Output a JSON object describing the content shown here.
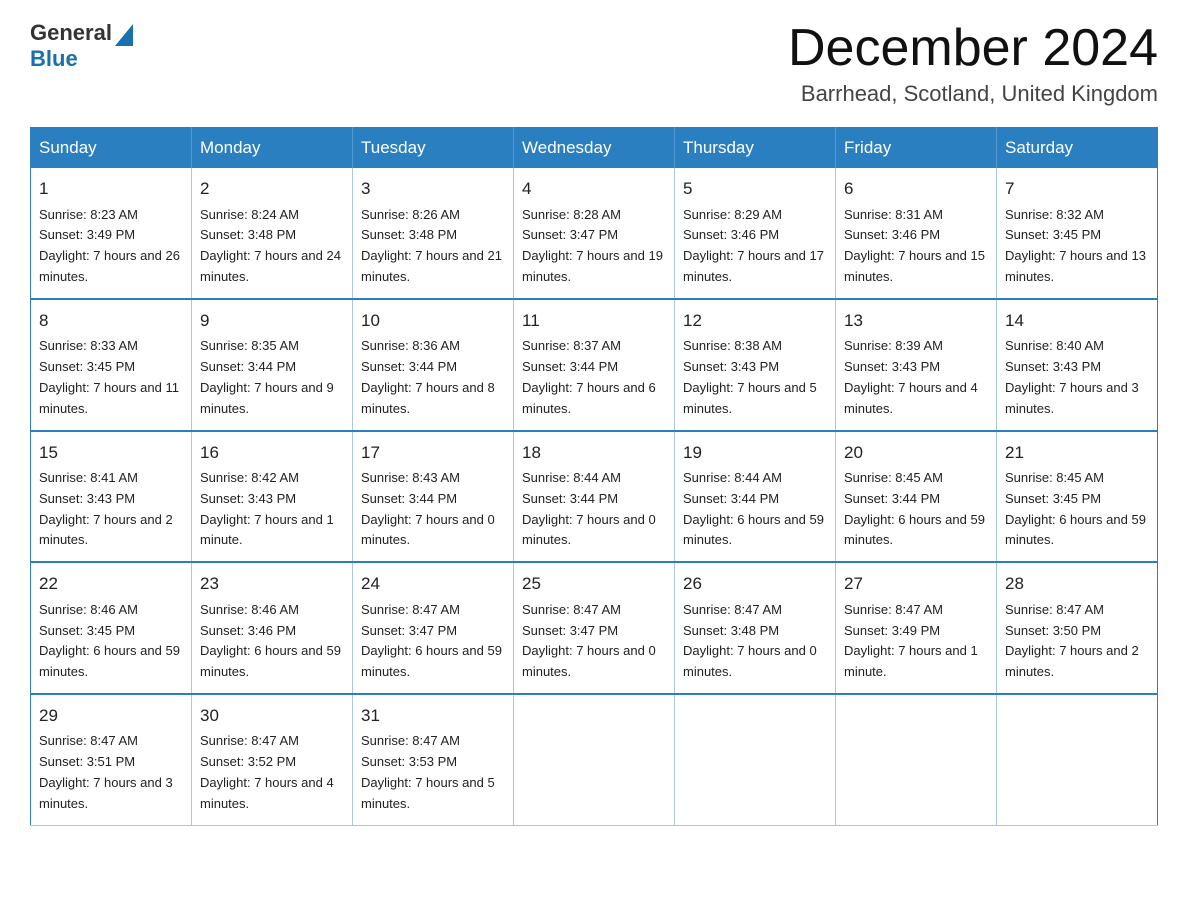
{
  "header": {
    "logo_general": "General",
    "logo_blue": "Blue",
    "month_title": "December 2024",
    "location": "Barrhead, Scotland, United Kingdom"
  },
  "days_of_week": [
    "Sunday",
    "Monday",
    "Tuesday",
    "Wednesday",
    "Thursday",
    "Friday",
    "Saturday"
  ],
  "weeks": [
    [
      {
        "day": "1",
        "sunrise": "8:23 AM",
        "sunset": "3:49 PM",
        "daylight": "7 hours and 26 minutes."
      },
      {
        "day": "2",
        "sunrise": "8:24 AM",
        "sunset": "3:48 PM",
        "daylight": "7 hours and 24 minutes."
      },
      {
        "day": "3",
        "sunrise": "8:26 AM",
        "sunset": "3:48 PM",
        "daylight": "7 hours and 21 minutes."
      },
      {
        "day": "4",
        "sunrise": "8:28 AM",
        "sunset": "3:47 PM",
        "daylight": "7 hours and 19 minutes."
      },
      {
        "day": "5",
        "sunrise": "8:29 AM",
        "sunset": "3:46 PM",
        "daylight": "7 hours and 17 minutes."
      },
      {
        "day": "6",
        "sunrise": "8:31 AM",
        "sunset": "3:46 PM",
        "daylight": "7 hours and 15 minutes."
      },
      {
        "day": "7",
        "sunrise": "8:32 AM",
        "sunset": "3:45 PM",
        "daylight": "7 hours and 13 minutes."
      }
    ],
    [
      {
        "day": "8",
        "sunrise": "8:33 AM",
        "sunset": "3:45 PM",
        "daylight": "7 hours and 11 minutes."
      },
      {
        "day": "9",
        "sunrise": "8:35 AM",
        "sunset": "3:44 PM",
        "daylight": "7 hours and 9 minutes."
      },
      {
        "day": "10",
        "sunrise": "8:36 AM",
        "sunset": "3:44 PM",
        "daylight": "7 hours and 8 minutes."
      },
      {
        "day": "11",
        "sunrise": "8:37 AM",
        "sunset": "3:44 PM",
        "daylight": "7 hours and 6 minutes."
      },
      {
        "day": "12",
        "sunrise": "8:38 AM",
        "sunset": "3:43 PM",
        "daylight": "7 hours and 5 minutes."
      },
      {
        "day": "13",
        "sunrise": "8:39 AM",
        "sunset": "3:43 PM",
        "daylight": "7 hours and 4 minutes."
      },
      {
        "day": "14",
        "sunrise": "8:40 AM",
        "sunset": "3:43 PM",
        "daylight": "7 hours and 3 minutes."
      }
    ],
    [
      {
        "day": "15",
        "sunrise": "8:41 AM",
        "sunset": "3:43 PM",
        "daylight": "7 hours and 2 minutes."
      },
      {
        "day": "16",
        "sunrise": "8:42 AM",
        "sunset": "3:43 PM",
        "daylight": "7 hours and 1 minute."
      },
      {
        "day": "17",
        "sunrise": "8:43 AM",
        "sunset": "3:44 PM",
        "daylight": "7 hours and 0 minutes."
      },
      {
        "day": "18",
        "sunrise": "8:44 AM",
        "sunset": "3:44 PM",
        "daylight": "7 hours and 0 minutes."
      },
      {
        "day": "19",
        "sunrise": "8:44 AM",
        "sunset": "3:44 PM",
        "daylight": "6 hours and 59 minutes."
      },
      {
        "day": "20",
        "sunrise": "8:45 AM",
        "sunset": "3:44 PM",
        "daylight": "6 hours and 59 minutes."
      },
      {
        "day": "21",
        "sunrise": "8:45 AM",
        "sunset": "3:45 PM",
        "daylight": "6 hours and 59 minutes."
      }
    ],
    [
      {
        "day": "22",
        "sunrise": "8:46 AM",
        "sunset": "3:45 PM",
        "daylight": "6 hours and 59 minutes."
      },
      {
        "day": "23",
        "sunrise": "8:46 AM",
        "sunset": "3:46 PM",
        "daylight": "6 hours and 59 minutes."
      },
      {
        "day": "24",
        "sunrise": "8:47 AM",
        "sunset": "3:47 PM",
        "daylight": "6 hours and 59 minutes."
      },
      {
        "day": "25",
        "sunrise": "8:47 AM",
        "sunset": "3:47 PM",
        "daylight": "7 hours and 0 minutes."
      },
      {
        "day": "26",
        "sunrise": "8:47 AM",
        "sunset": "3:48 PM",
        "daylight": "7 hours and 0 minutes."
      },
      {
        "day": "27",
        "sunrise": "8:47 AM",
        "sunset": "3:49 PM",
        "daylight": "7 hours and 1 minute."
      },
      {
        "day": "28",
        "sunrise": "8:47 AM",
        "sunset": "3:50 PM",
        "daylight": "7 hours and 2 minutes."
      }
    ],
    [
      {
        "day": "29",
        "sunrise": "8:47 AM",
        "sunset": "3:51 PM",
        "daylight": "7 hours and 3 minutes."
      },
      {
        "day": "30",
        "sunrise": "8:47 AM",
        "sunset": "3:52 PM",
        "daylight": "7 hours and 4 minutes."
      },
      {
        "day": "31",
        "sunrise": "8:47 AM",
        "sunset": "3:53 PM",
        "daylight": "7 hours and 5 minutes."
      },
      null,
      null,
      null,
      null
    ]
  ]
}
